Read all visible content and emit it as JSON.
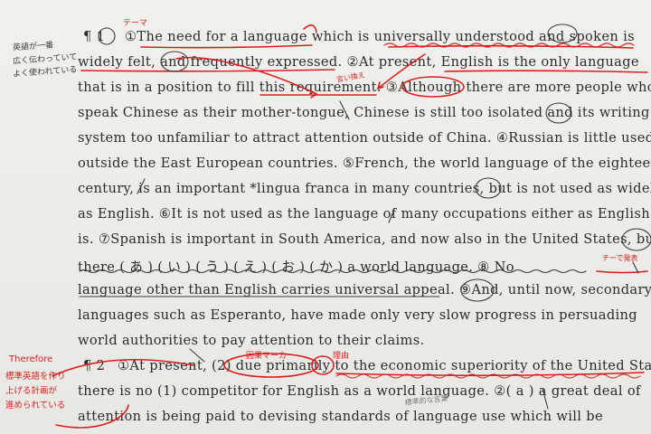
{
  "paragraph1": {
    "marker": "¶ 1",
    "lines": [
      "①The need for a language which is universally understood and spoken is",
      "widely felt, and frequently expressed. ②At present, English is the only language",
      "that is in a position to fill this requirement. ③Although there are more people who",
      "speak Chinese as their mother-tongue, Chinese is still too isolated and its writing",
      "system too unfamiliar to attract attention outside of China. ④Russian is little used",
      "outside the East European countries. ⑤French, the world language of the eighteenth",
      "century, is an important *lingua franca in many countries, but is not used as widely",
      "as English. ⑥It is not used as the language of many occupations either as English",
      "is. ⑦Spanish is important in South America, and now also in the United States, but",
      "there ( あ ) ( い ) ( う ) ( え ) ( お ) ( か ) a world language. ⑧ No",
      "language other than English carries universal appeal. ⑨And, until now, secondary",
      "languages such as Esperanto, have made only very slow progress in persuading",
      "world authorities to pay attention to their claims."
    ]
  },
  "paragraph2": {
    "marker": "¶ 2",
    "lines": [
      "①At present, (2) due primarily to the economic superiority of the United States,",
      "there is no (1) competitor for English as a world language. ②( a ) a great deal of",
      "attention is being paid to devising standards of language use which will be"
    ]
  },
  "annotations": {
    "left_margin_top": [
      "英語が一番",
      "広く伝わっていて",
      "よく使われている"
    ],
    "left_margin_bottom": [
      "Therefore",
      "標準英語を作り",
      "上げる計画が",
      "進められている"
    ],
    "theme": "テーマ",
    "say_this": "言い換え",
    "reason": "理由",
    "causal_marker": "因果マーカー",
    "spanish_note": "チーで発表"
  },
  "colors": {
    "paper": "#ecebe7",
    "text": "#2b2b2b",
    "red_ink": "#d62020"
  }
}
